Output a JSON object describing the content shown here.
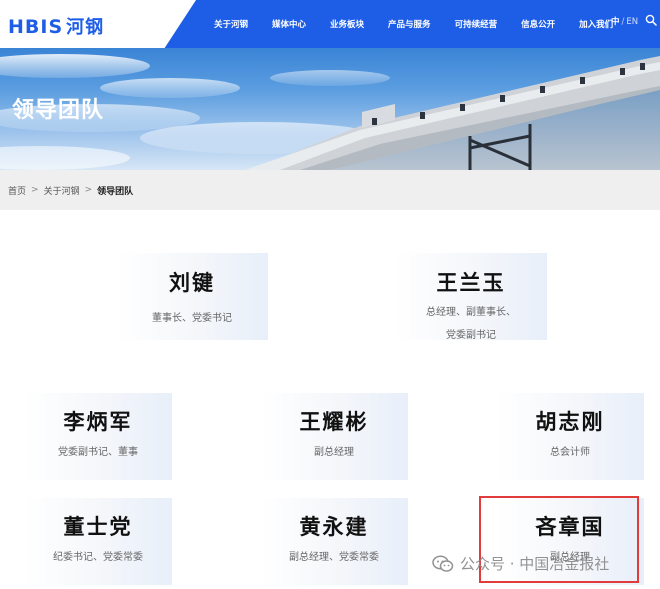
{
  "header": {
    "logo_latin": "HBIS",
    "logo_cn": "河钢",
    "nav": [
      "关于河钢",
      "媒体中心",
      "业务板块",
      "产品与服务",
      "可持续经营",
      "信息公开",
      "加入我们"
    ],
    "lang_active": "中",
    "lang_sep": "/",
    "lang_other": "EN",
    "search_icon": "search-icon",
    "colors": {
      "nav_bg": "#1e5ee6",
      "brand": "#1e5ee6"
    }
  },
  "banner": {
    "title": "领导团队"
  },
  "breadcrumb": {
    "items": [
      "首页",
      "关于河钢",
      "领导团队"
    ],
    "separator": ">"
  },
  "leaders": [
    {
      "name": "刘键",
      "title": "董事长、党委书记"
    },
    {
      "name": "王兰玉",
      "title_line1": "总经理、副董事长、",
      "title_line2": "党委副书记"
    },
    {
      "name": "李炳军",
      "title": "党委副书记、董事"
    },
    {
      "name": "王耀彬",
      "title": "副总经理"
    },
    {
      "name": "胡志刚",
      "title": "总会计师"
    },
    {
      "name": "董士党",
      "title": "纪委书记、党委常委"
    },
    {
      "name": "黄永建",
      "title": "副总经理、党委常委"
    },
    {
      "name": "吝章国",
      "title": "副总经理"
    }
  ],
  "highlight_color": "#e23b3b",
  "watermark": {
    "icon": "wechat-icon",
    "text": "公众号 · 中国冶金报社"
  }
}
